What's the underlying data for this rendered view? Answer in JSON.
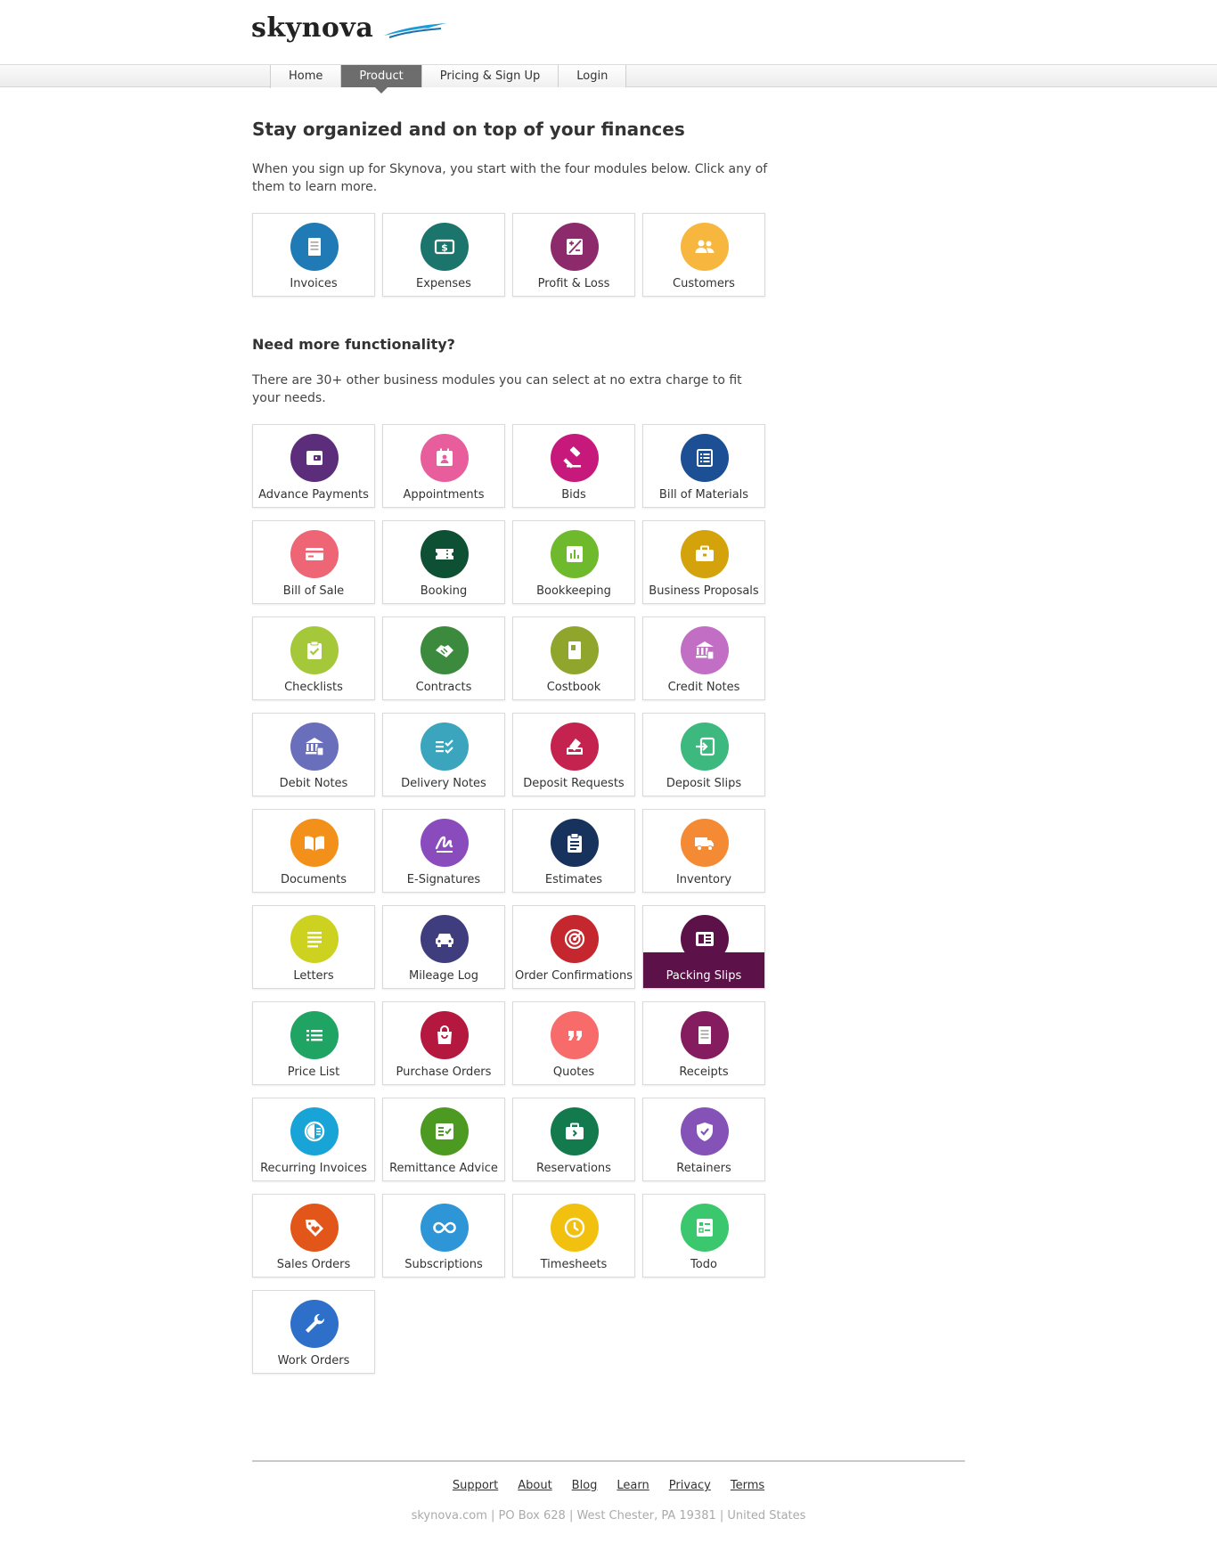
{
  "brand": {
    "name": "skynova"
  },
  "nav": [
    {
      "label": "Home",
      "active": false
    },
    {
      "label": "Product",
      "active": true
    },
    {
      "label": "Pricing & Sign Up",
      "active": false
    },
    {
      "label": "Login",
      "active": false
    }
  ],
  "main": {
    "title": "Stay organized and on top of your finances",
    "intro": "When you sign up for Skynova, you start with the four modules below. Click any of them to learn more.",
    "more_title": "Need more functionality?",
    "more_intro": "There are 30+ other business modules you can select at no extra charge to fit your needs."
  },
  "core_modules": [
    {
      "label": "Invoices",
      "color": "#1f7ab5",
      "icon": "receipt-icon"
    },
    {
      "label": "Expenses",
      "color": "#1b756c",
      "icon": "dollar-bill-icon"
    },
    {
      "label": "Profit & Loss",
      "color": "#8d2a6b",
      "icon": "plus-minus-icon"
    },
    {
      "label": "Customers",
      "color": "#f7b63e",
      "icon": "users-icon"
    }
  ],
  "extra_modules": [
    {
      "label": "Advance Payments",
      "color": "#5b2d7a",
      "icon": "wallet-icon"
    },
    {
      "label": "Appointments",
      "color": "#e85e9c",
      "icon": "calendar-icon"
    },
    {
      "label": "Bids",
      "color": "#c7197c",
      "icon": "gavel-icon"
    },
    {
      "label": "Bill of Materials",
      "color": "#1c4f94",
      "icon": "list-icon"
    },
    {
      "label": "Bill of Sale",
      "color": "#ee6575",
      "icon": "card-icon"
    },
    {
      "label": "Booking",
      "color": "#0e5034",
      "icon": "ticket-icon"
    },
    {
      "label": "Bookkeeping",
      "color": "#6fba2c",
      "icon": "chart-icon"
    },
    {
      "label": "Business Proposals",
      "color": "#d4a20b",
      "icon": "briefcase-icon"
    },
    {
      "label": "Checklists",
      "color": "#a4c83a",
      "icon": "clipboard-check-icon"
    },
    {
      "label": "Contracts",
      "color": "#3b8a3d",
      "icon": "handshake-icon"
    },
    {
      "label": "Costbook",
      "color": "#8fa52c",
      "icon": "book-icon"
    },
    {
      "label": "Credit Notes",
      "color": "#c26ec4",
      "icon": "bank-icon"
    },
    {
      "label": "Debit Notes",
      "color": "#6a6fbb",
      "icon": "bank-icon"
    },
    {
      "label": "Delivery Notes",
      "color": "#3aa5bd",
      "icon": "checklist-icon"
    },
    {
      "label": "Deposit Requests",
      "color": "#c4234f",
      "icon": "eraser-icon"
    },
    {
      "label": "Deposit Slips",
      "color": "#3db87f",
      "icon": "sign-in-icon"
    },
    {
      "label": "Documents",
      "color": "#f2901a",
      "icon": "open-book-icon"
    },
    {
      "label": "E-Signatures",
      "color": "#8a4bbd",
      "icon": "signature-icon"
    },
    {
      "label": "Estimates",
      "color": "#17325c",
      "icon": "clipboard-icon"
    },
    {
      "label": "Inventory",
      "color": "#f58a35",
      "icon": "truck-icon"
    },
    {
      "label": "Letters",
      "color": "#cdd220",
      "icon": "text-lines-icon"
    },
    {
      "label": "Mileage Log",
      "color": "#3f3d7e",
      "icon": "car-icon"
    },
    {
      "label": "Order Confirmations",
      "color": "#c4272d",
      "icon": "target-icon"
    },
    {
      "label": "Packing Slips",
      "color": "#5c1149",
      "icon": "newspaper-icon",
      "highlight": true
    },
    {
      "label": "Price List",
      "color": "#1fa463",
      "icon": "price-list-icon"
    },
    {
      "label": "Purchase Orders",
      "color": "#b5183f",
      "icon": "bag-icon"
    },
    {
      "label": "Quotes",
      "color": "#f76b6b",
      "icon": "quote-icon"
    },
    {
      "label": "Receipts",
      "color": "#841c5f",
      "icon": "receipt-icon"
    },
    {
      "label": "Recurring Invoices",
      "color": "#18a4d6",
      "icon": "half-circle-icon"
    },
    {
      "label": "Remittance Advice",
      "color": "#4d9a23",
      "icon": "checklist-box-icon"
    },
    {
      "label": "Reservations",
      "color": "#137a4d",
      "icon": "briefcase-arrow-icon"
    },
    {
      "label": "Retainers",
      "color": "#8552b8",
      "icon": "shield-icon"
    },
    {
      "label": "Sales Orders",
      "color": "#e2561a",
      "icon": "tag-heart-icon"
    },
    {
      "label": "Subscriptions",
      "color": "#2e95d7",
      "icon": "infinity-icon"
    },
    {
      "label": "Timesheets",
      "color": "#f2c10f",
      "icon": "clock-icon"
    },
    {
      "label": "Todo",
      "color": "#3bc76d",
      "icon": "todo-icon"
    },
    {
      "label": "Work Orders",
      "color": "#2d6fc9",
      "icon": "wrench-icon"
    }
  ],
  "footer": {
    "links": [
      "Support",
      "About",
      "Blog",
      "Learn",
      "Privacy",
      "Terms"
    ],
    "address": "skynova.com | PO Box 628 | West Chester, PA 19381 | United States"
  }
}
